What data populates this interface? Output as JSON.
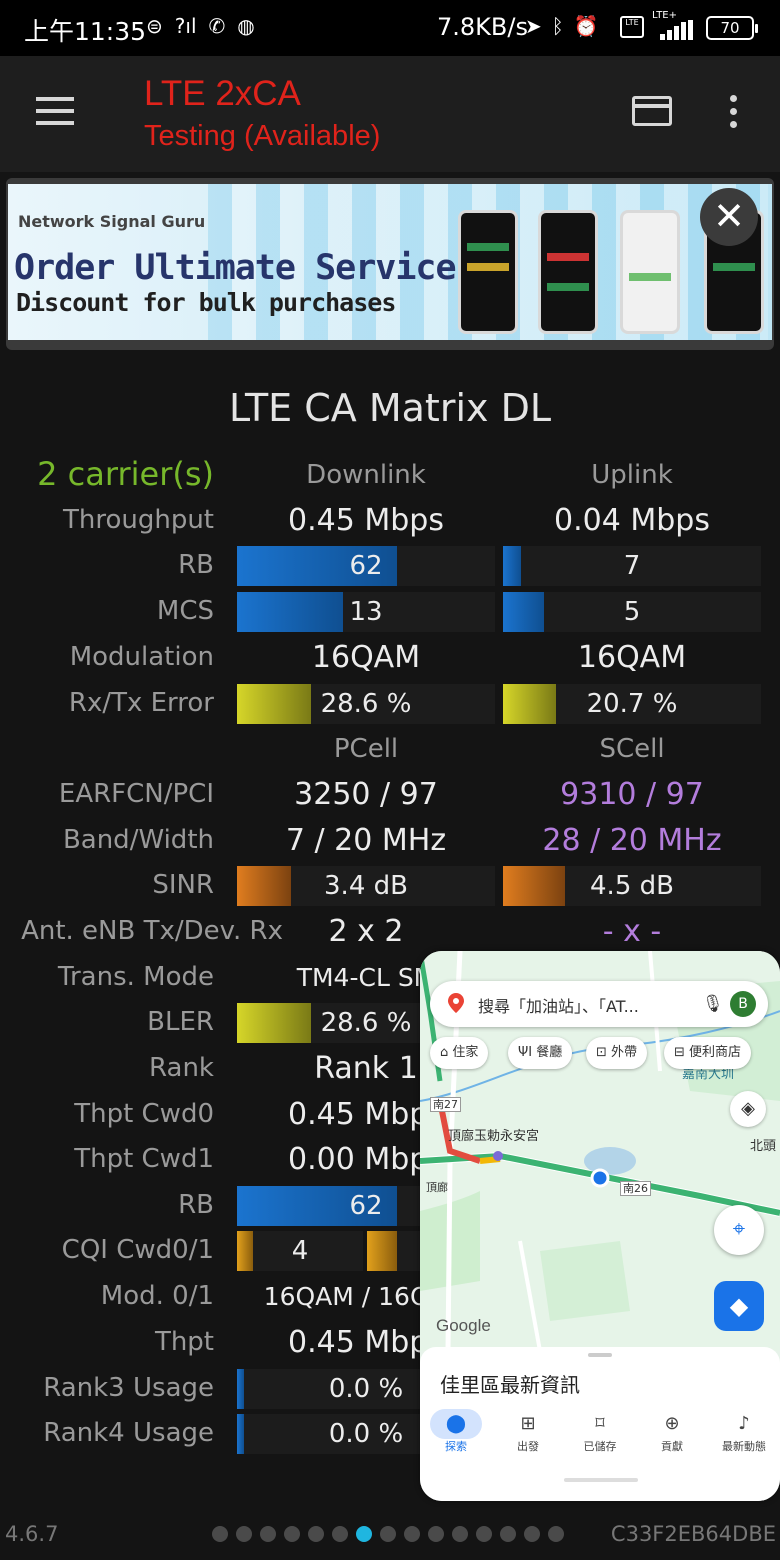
{
  "status_bar": {
    "time": "上午11:35",
    "left_icons": [
      "2CC-icon",
      "wifi-calling-icon",
      "phone-forward-icon",
      "messenger-icon"
    ],
    "speed": "7.8KB/s",
    "lte_badge": "LTE",
    "lte_plus": "LTE+",
    "battery": "70"
  },
  "app_bar": {
    "title": "LTE 2xCA",
    "subtitle": "Testing (Available)"
  },
  "ad": {
    "brand": "Network Signal Guru",
    "title": "Order Ultimate Service",
    "subtitle": "Discount for bulk purchases",
    "close": "✕"
  },
  "matrix": {
    "title": "LTE CA Matrix DL",
    "carriers": "2 carrier(s)",
    "downlink_header": "Downlink",
    "uplink_header": "Uplink",
    "throughput": {
      "label": "Throughput",
      "dl": "0.45 Mbps",
      "ul": "0.04 Mbps"
    },
    "rb": {
      "label": "RB",
      "dl": "62",
      "ul": "7",
      "dl_fill": 0.62,
      "ul_fill": 0.07
    },
    "mcs": {
      "label": "MCS",
      "dl": "13",
      "ul": "5",
      "dl_fill": 0.41,
      "ul_fill": 0.16
    },
    "modulation": {
      "label": "Modulation",
      "dl": "16QAM",
      "ul": "16QAM"
    },
    "rxtx_error": {
      "label": "Rx/Tx Error",
      "dl": "28.6 %",
      "ul": "20.7 %",
      "dl_fill": 0.286,
      "ul_fill": 0.207
    },
    "pcell_header": "PCell",
    "scell_header": "SCell",
    "earfcn": {
      "label": "EARFCN/PCI",
      "p": "3250 / 97",
      "s": "9310 / 97"
    },
    "band": {
      "label": "Band/Width",
      "p": "7 / 20 MHz",
      "s": "28 / 20 MHz"
    },
    "sinr": {
      "label": "SINR",
      "p": "3.4 dB",
      "s": "4.5 dB",
      "p_fill": 0.21,
      "s_fill": 0.24
    },
    "antenna": {
      "label": "Ant. eNB Tx/Dev. Rx",
      "p": "2 x 2",
      "s": "- x -"
    },
    "trans_mode": {
      "label": "Trans. Mode",
      "p": "TM4-CL SM"
    },
    "bler": {
      "label": "BLER",
      "p": "28.6 %",
      "p_fill": 0.286
    },
    "rank": {
      "label": "Rank",
      "p": "Rank 1"
    },
    "thpt_cwd0": {
      "label": "Thpt Cwd0",
      "p": "0.45 Mbps"
    },
    "thpt_cwd1": {
      "label": "Thpt Cwd1",
      "p": "0.00 Mbps"
    },
    "rb2": {
      "label": "RB",
      "p": "62",
      "p_fill": 0.62
    },
    "cqi": {
      "label": "CQI Cwd0/1",
      "p": "4"
    },
    "mod01": {
      "label": "Mod. 0/1",
      "p": "16QAM / 16QAM"
    },
    "thpt": {
      "label": "Thpt",
      "p": "0.45 Mbps"
    },
    "rank3": {
      "label": "Rank3 Usage",
      "p": "0.0 %",
      "p_fill": 0.0
    },
    "rank4": {
      "label": "Rank4 Usage",
      "p": "0.0 %",
      "p_fill": 0.0
    }
  },
  "footer": {
    "version": "4.6.7",
    "device_id": "C33F2EB64DBE",
    "page_count": 15,
    "active_page": 6
  },
  "maps": {
    "search_placeholder": "搜尋「加油站」、「AT...",
    "avatar": "B",
    "chips": [
      "住家",
      "餐廳",
      "外帶",
      "便利商店"
    ],
    "place_label": "頂廍玉勅永安宮",
    "road_1": "南27",
    "road_2": "南26",
    "area_label": "嘉南大圳",
    "north_label": "北頭",
    "small_label": "頂廊",
    "google": "Google",
    "sheet_title": "佳里區最新資訊",
    "nav": [
      "探索",
      "出發",
      "已儲存",
      "貢獻",
      "最新動態"
    ]
  },
  "colors": {
    "title_red": "#e0231b",
    "green": "#77b82b",
    "purple": "#b37ddc",
    "bar_blue": "#1b74cf",
    "bar_yellow": "#d6d629",
    "bar_orange": "#e07d1f",
    "maps_blue": "#1a73e8"
  }
}
